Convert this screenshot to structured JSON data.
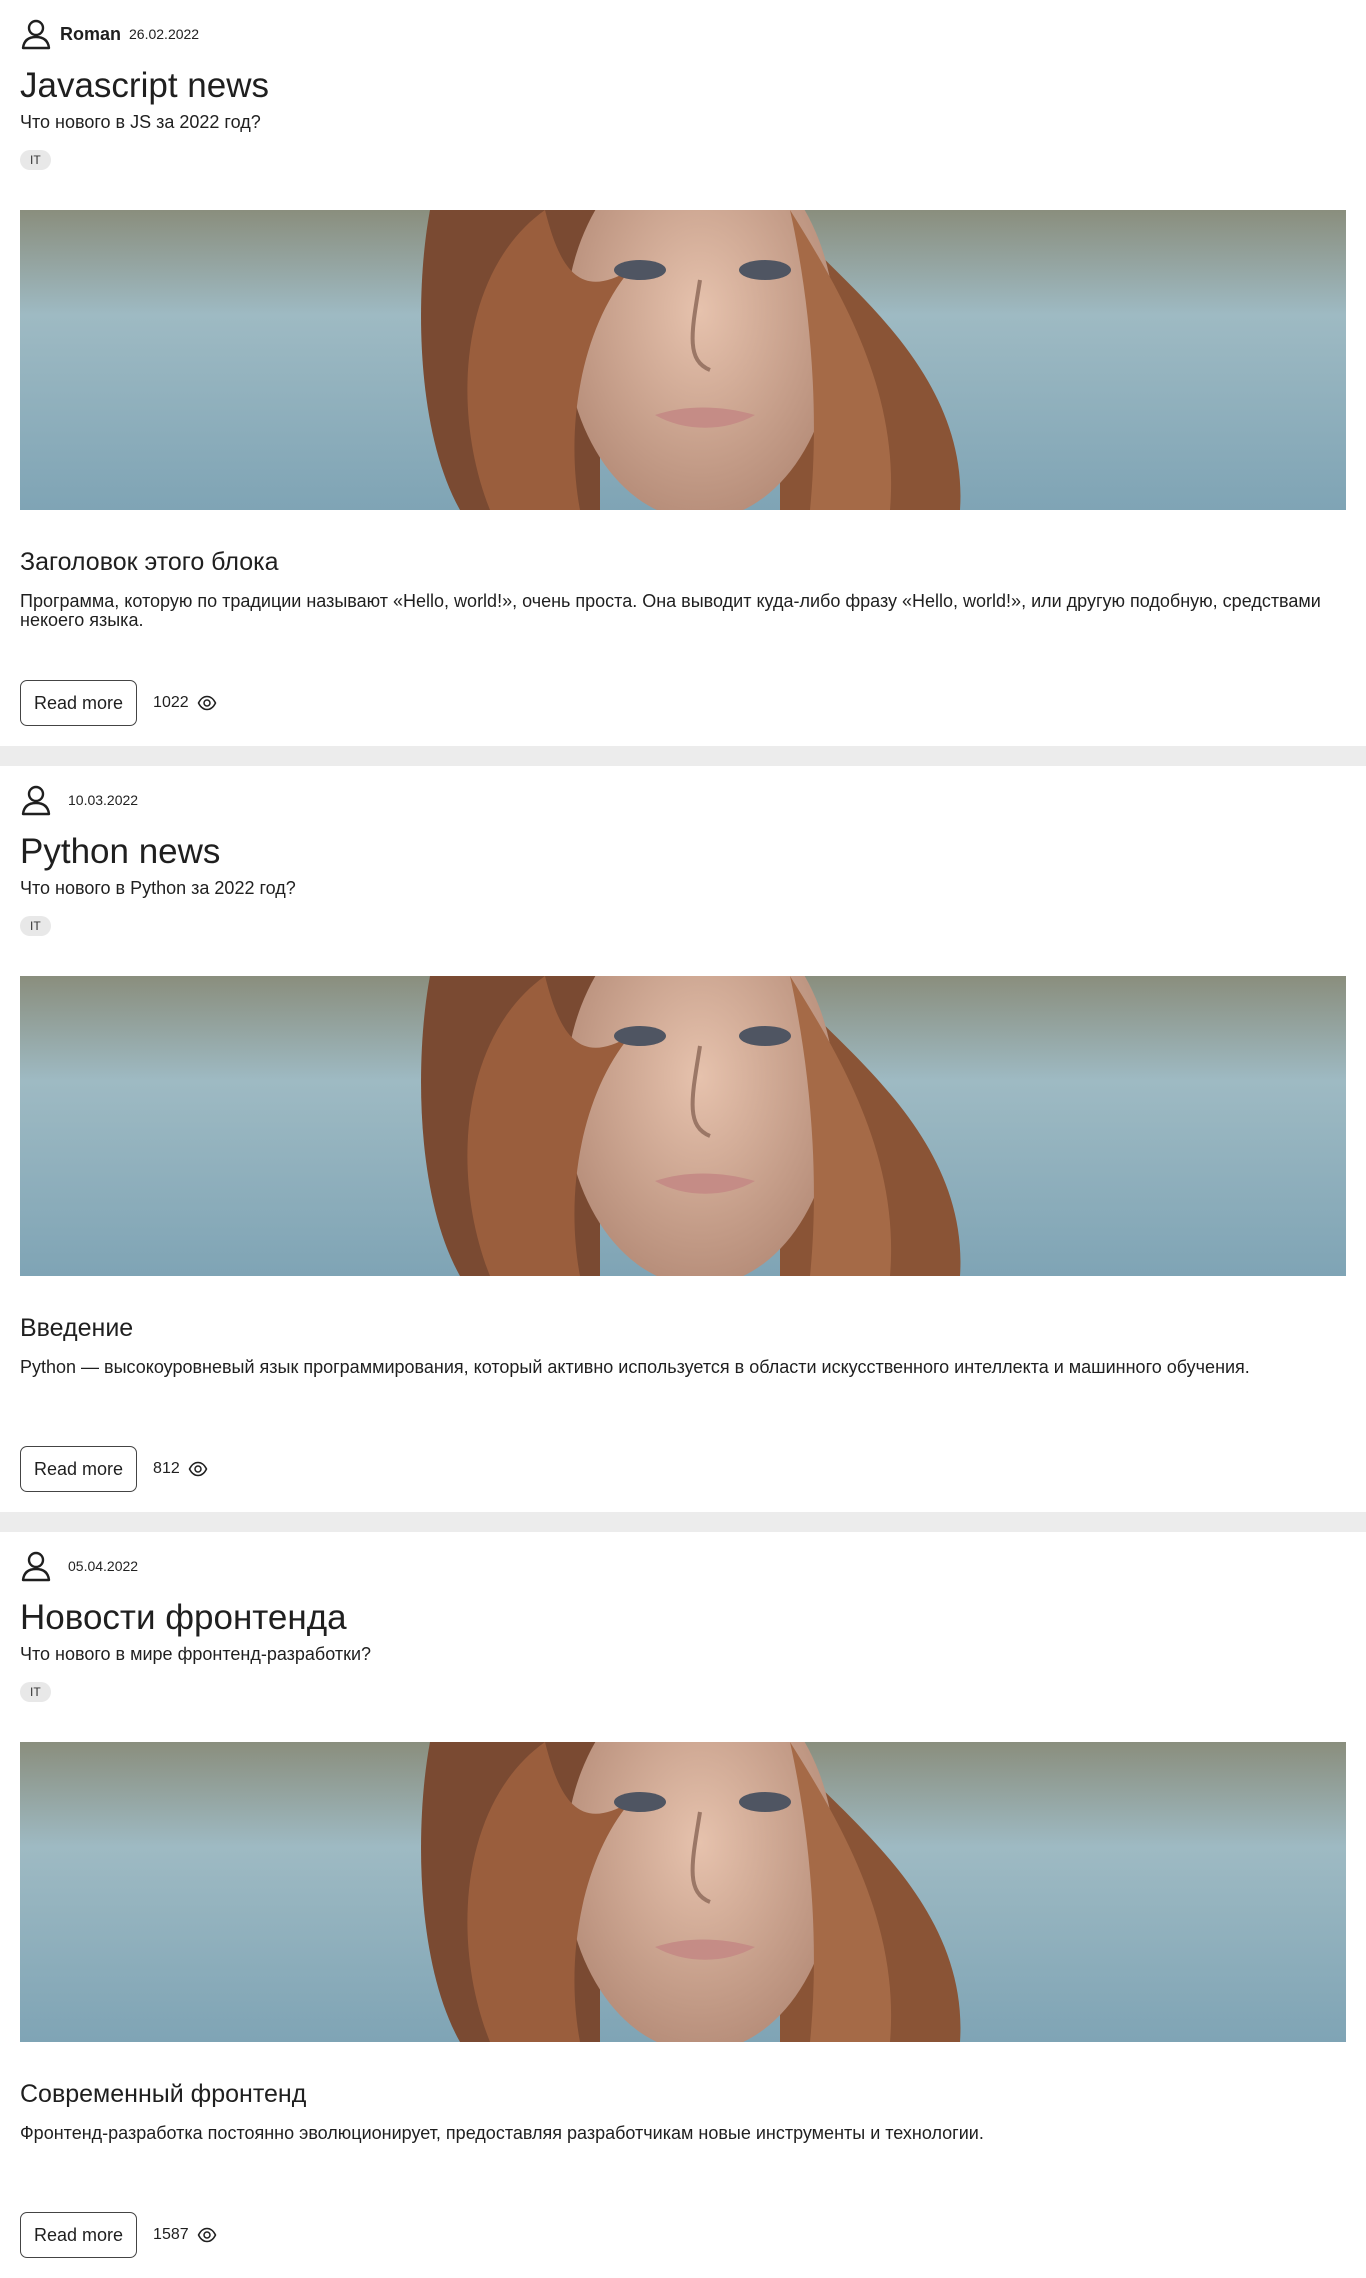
{
  "articles": [
    {
      "author": "Roman",
      "date": "26.02.2022",
      "title": "Javascript news",
      "subtitle": "Что нового в JS за 2022 год?",
      "tag": "IT",
      "block_title": "Заголовок этого блока",
      "block_text": "Программа, которую по традиции называют «Hello, world!», очень проста. Она выводит куда-либо фразу «Hello, world!», или другую подобную, средствами некоего языка.",
      "read_more_label": "Read more",
      "views": "1022"
    },
    {
      "author": "",
      "date": "10.03.2022",
      "title": "Python news",
      "subtitle": "Что нового в Python за 2022 год?",
      "tag": "IT",
      "block_title": "Введение",
      "block_text": "Python — высокоуровневый язык программирования, который активно используется в области искусственного интеллекта и машинного обучения.",
      "read_more_label": "Read more",
      "views": "812"
    },
    {
      "author": "",
      "date": "05.04.2022",
      "title": "Новости фронтенда",
      "subtitle": "Что нового в мире фронтенд-разработки?",
      "tag": "IT",
      "block_title": "Современный фронтенд",
      "block_text": "Фронтенд-разработка постоянно эволюционирует, предоставляя разработчикам новые инструменты и технологии.",
      "read_more_label": "Read more",
      "views": "1587"
    }
  ],
  "icons": {
    "avatar": "user-icon",
    "views": "eye-icon"
  },
  "colors": {
    "separator": "#ececec",
    "tag_background": "#e8e8e8",
    "text": "#1f1f1f"
  }
}
